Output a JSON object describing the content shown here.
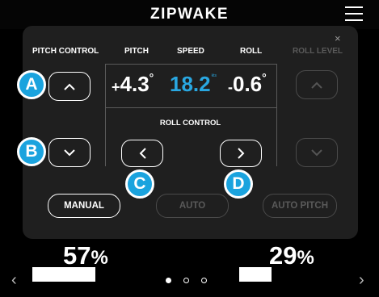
{
  "header": {
    "brand": "ZIPWAKE",
    "menu_icon": "hamburger-menu-icon"
  },
  "panel": {
    "close_icon": "close-icon",
    "close_glyph": "×",
    "labels": {
      "pitch_control": "PITCH CONTROL",
      "pitch": "PITCH",
      "speed": "SPEED",
      "roll": "ROLL",
      "roll_level": "ROLL LEVEL",
      "roll_control": "ROLL CONTROL"
    },
    "readouts": {
      "pitch": {
        "sign": "+",
        "value": "4.3",
        "unit": "°"
      },
      "speed": {
        "value": "18.2",
        "unit": "kts"
      },
      "roll": {
        "sign": "-",
        "value": "0.6",
        "unit": "°"
      }
    },
    "modes": {
      "manual": "MANUAL",
      "auto": "AUTO",
      "auto_pitch": "AUTO PITCH"
    },
    "active_mode": "MANUAL"
  },
  "markers": {
    "a": "A",
    "b": "B",
    "c": "C",
    "d": "D"
  },
  "interceptors": {
    "left": {
      "value": "57",
      "unit": "%",
      "fill": 0.57
    },
    "right": {
      "value": "29",
      "unit": "%",
      "fill": 0.29
    }
  },
  "pager": {
    "total": 3,
    "active": 1
  },
  "colors": {
    "accent": "#29a7e1",
    "panel": "#1f1f1f",
    "background": "#000000"
  }
}
